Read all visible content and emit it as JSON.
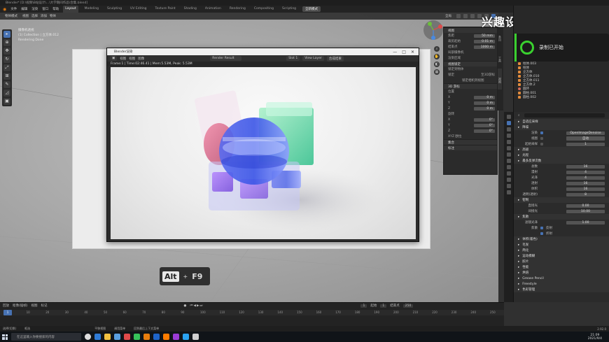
{
  "window": {
    "title": "Blender* [D:\\视频\\B站设计\\...\\大学期间作品\\合集.blend]"
  },
  "menubar": {
    "menus": [
      "文件",
      "编辑",
      "渲染",
      "窗口",
      "帮助"
    ],
    "workspaces": [
      "Layout",
      "Modeling",
      "Sculpting",
      "UV Editing",
      "Texture Paint",
      "Shading",
      "Animation",
      "Rendering",
      "Compositing",
      "Scripting"
    ],
    "active_workspace": "Layout",
    "add_button": "全新模式",
    "scene": "Scene",
    "view_layer": "View Layer"
  },
  "viewport": {
    "mode": "物体模式",
    "header_items": [
      "视图",
      "选择",
      "添加",
      "物体"
    ],
    "info_lines": [
      "摄像机透视",
      "(1) Collection | 立方体.012",
      "Rendering Done"
    ],
    "transform": "全局",
    "tools": [
      "select",
      "cursor",
      "move",
      "rotate",
      "scale",
      "transform",
      "annotate",
      "measure",
      "add-cube"
    ]
  },
  "render_window": {
    "title": "Blender渲染",
    "header_items": [
      "视图",
      "视图",
      "图像"
    ],
    "image_name": "Render Result",
    "slot": "Slot 1",
    "view_layer": "View Layer",
    "pass": "合成结果",
    "stats": "Frame:1 | Time:02:46.41 | Mem:5.53M, Peak: 5.53M",
    "window_controls": [
      "—",
      "□",
      "✕"
    ]
  },
  "npanel": {
    "tabs": [
      "条目",
      "工具",
      "视图"
    ],
    "sections": [
      {
        "title": "视图",
        "props": [
          {
            "label": "焦距",
            "value": "50 mm"
          },
          {
            "label": "裁剪起始",
            "value": "0.01 m"
          },
          {
            "label": "结束点",
            "value": "1000 m"
          },
          {
            "label": "局部摄像机",
            "value": ""
          },
          {
            "label": "渲染区域",
            "value": ""
          }
        ]
      },
      {
        "title": "视图锁定",
        "props": [
          {
            "label": "锁定到物体",
            "value": ""
          },
          {
            "label": "锁定",
            "value": "至3D游标"
          },
          {
            "label": "",
            "value": "锁定相机到视图"
          }
        ]
      },
      {
        "title": "3D 游标",
        "props": [
          {
            "label": "位置",
            "value": ""
          },
          {
            "label": "X",
            "value": "0 m"
          },
          {
            "label": "Y",
            "value": "0 m"
          },
          {
            "label": "Z",
            "value": "0 m"
          },
          {
            "label": "旋转",
            "value": ""
          },
          {
            "label": "X",
            "value": "0°"
          },
          {
            "label": "Y",
            "value": "0°"
          },
          {
            "label": "Z",
            "value": "0°"
          },
          {
            "label": "XYZ 欧拉",
            "value": ""
          }
        ]
      },
      {
        "title": "集合",
        "props": []
      },
      {
        "title": "标注",
        "props": []
      }
    ]
  },
  "watermark": "兴趣设计师k bilibili",
  "recording": {
    "text": "录制已开始"
  },
  "outliner": {
    "items": [
      {
        "name": "柱体.003",
        "type": "mesh"
      },
      {
        "name": "柱体",
        "type": "mesh"
      },
      {
        "name": "立方体",
        "type": "mesh"
      },
      {
        "name": "立方体.010",
        "type": "mesh"
      },
      {
        "name": "立方体.011",
        "type": "mesh"
      },
      {
        "name": "立方体.2",
        "type": "mesh"
      },
      {
        "name": "圆环",
        "type": "mesh"
      },
      {
        "name": "圆柱.001",
        "type": "mesh"
      },
      {
        "name": "圆柱.002",
        "type": "mesh"
      }
    ]
  },
  "properties": {
    "rows": [
      {
        "type": "head",
        "label": "自适应采样"
      },
      {
        "type": "head",
        "label": "降噪"
      },
      {
        "type": "field",
        "label": "渲染",
        "value": "OpenImageDenoise",
        "check": true
      },
      {
        "type": "field",
        "label": "视图",
        "value": "自动",
        "check": false
      },
      {
        "type": "field",
        "label": "起始采样",
        "value": "1",
        "check": false
      },
      {
        "type": "head",
        "label": "高级"
      },
      {
        "type": "head",
        "label": "光程"
      },
      {
        "type": "head",
        "label": "最多反弹次数"
      },
      {
        "type": "field",
        "label": "总数",
        "value": "16"
      },
      {
        "type": "field",
        "label": "漫射",
        "value": "4"
      },
      {
        "type": "field",
        "label": "光泽",
        "value": "4"
      },
      {
        "type": "field",
        "label": "透射",
        "value": "16"
      },
      {
        "type": "field",
        "label": "体积",
        "value": "16"
      },
      {
        "type": "field",
        "label": "透明(透射)",
        "value": "8"
      },
      {
        "type": "head",
        "label": "钳制"
      },
      {
        "type": "field",
        "label": "直接光",
        "value": "0.00"
      },
      {
        "type": "field",
        "label": "间接光",
        "value": "10.00"
      },
      {
        "type": "head",
        "label": "焦散"
      },
      {
        "type": "field",
        "label": "滤镜光泽",
        "value": "1.00"
      },
      {
        "type": "check",
        "label": "焦散",
        "value": "反射",
        "check": true
      },
      {
        "type": "check",
        "label": "",
        "value": "折射",
        "check": true
      },
      {
        "type": "head",
        "label": "体积(着色)"
      },
      {
        "type": "head",
        "label": "毛发"
      },
      {
        "type": "head",
        "label": "简化"
      },
      {
        "type": "head",
        "label": "运动模糊"
      },
      {
        "type": "head",
        "label": "胶片"
      },
      {
        "type": "head",
        "label": "性能"
      },
      {
        "type": "head",
        "label": "烘焙"
      },
      {
        "type": "head",
        "label": "Grease Pencil"
      },
      {
        "type": "head",
        "label": "Freestyle"
      },
      {
        "type": "head",
        "label": "色彩管理"
      }
    ]
  },
  "key_hint": {
    "mod": "Alt",
    "plus": "+",
    "key": "F9"
  },
  "timeline": {
    "header_items": [
      "回放",
      "抠像(插帧)",
      "视图",
      "标记"
    ],
    "current_frame": "1",
    "start_label": "起始",
    "start": "1",
    "end_label": "结束点",
    "end": "250",
    "ticks": [
      "1",
      "10",
      "20",
      "30",
      "40",
      "50",
      "60",
      "70",
      "80",
      "90",
      "100",
      "110",
      "120",
      "130",
      "140",
      "150",
      "160",
      "170",
      "180",
      "190",
      "200",
      "210",
      "220",
      "230",
      "240",
      "250"
    ]
  },
  "statusbar": {
    "items": [
      "选择(切换)",
      "框选",
      "平移视图",
      "调用菜单",
      "回到最后上下文菜单"
    ],
    "version": "2.92.0"
  },
  "taskbar": {
    "search_placeholder": "在这里输入你要搜索的内容",
    "time": "21:09",
    "date": "2021/9/4"
  },
  "colors": {
    "accent": "#4772b3",
    "record_green": "#3ad12f",
    "object_orange": "#e08a3c"
  }
}
